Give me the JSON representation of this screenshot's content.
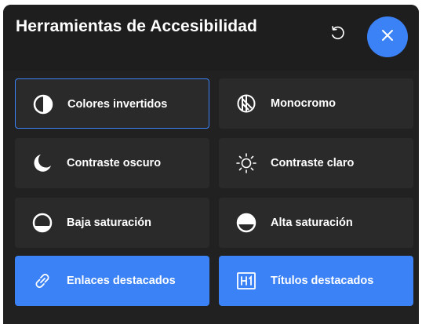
{
  "header": {
    "title": "Herramientas de Accesibilidad"
  },
  "colors": {
    "accent": "#3b82f6",
    "panel": "#212121",
    "tile": "#2a2a2a"
  },
  "tools": [
    {
      "label": "Colores invertidos",
      "icon": "invert-colors-icon",
      "state": "focused"
    },
    {
      "label": "Monocromo",
      "icon": "monochrome-icon",
      "state": "off"
    },
    {
      "label": "Contraste oscuro",
      "icon": "moon-icon",
      "state": "off"
    },
    {
      "label": "Contraste claro",
      "icon": "sun-icon",
      "state": "off"
    },
    {
      "label": "Baja saturación",
      "icon": "low-saturation-icon",
      "state": "off"
    },
    {
      "label": "Alta saturación",
      "icon": "high-saturation-icon",
      "state": "off"
    },
    {
      "label": "Enlaces destacados",
      "icon": "link-icon",
      "state": "active"
    },
    {
      "label": "Títulos destacados",
      "icon": "heading-icon",
      "state": "active"
    }
  ]
}
